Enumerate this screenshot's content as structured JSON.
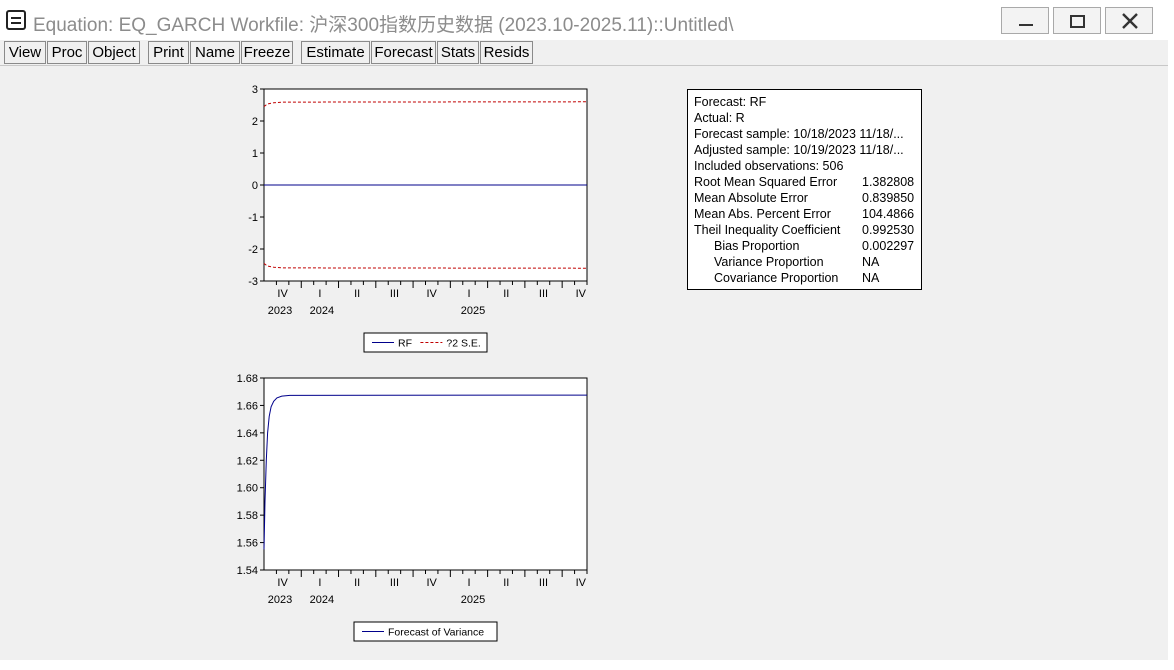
{
  "window": {
    "title": "Equation: EQ_GARCH   Workfile: 沪深300指数历史数据 (2023.10-2025.11)::Untitled\\",
    "controls": [
      "minimize",
      "maximize",
      "close"
    ]
  },
  "toolbar": {
    "buttons": [
      "View",
      "Proc",
      "Object",
      "Print",
      "Name",
      "Freeze",
      "Estimate",
      "Forecast",
      "Stats",
      "Resids"
    ]
  },
  "forecast_stats": {
    "rows": [
      {
        "label": "Forecast: RF",
        "value": ""
      },
      {
        "label": "Actual: R",
        "value": ""
      },
      {
        "label": "Forecast sample: 10/18/2023 11/18/...",
        "value": ""
      },
      {
        "label": "Adjusted sample: 10/19/2023 11/18/...",
        "value": ""
      },
      {
        "label": "Included observations: 506",
        "value": ""
      },
      {
        "label": "Root Mean Squared Error",
        "value": "1.382808"
      },
      {
        "label": "Mean Absolute Error",
        "value": "0.839850"
      },
      {
        "label": "Mean Abs. Percent Error",
        "value": "104.4866"
      },
      {
        "label": "Theil Inequality Coefficient",
        "value": "0.992530"
      },
      {
        "label": "Bias Proportion",
        "value": "0.002297",
        "indent": true
      },
      {
        "label": "Variance Proportion",
        "value": "NA",
        "indent": true
      },
      {
        "label": "Covariance Proportion",
        "value": "NA",
        "indent": true
      }
    ]
  },
  "chart_data": [
    {
      "type": "line",
      "x_ticks": [
        "IV",
        "I",
        "II",
        "III",
        "IV",
        "I",
        "II",
        "III",
        "IV"
      ],
      "year_labels": [
        "2023",
        "2024",
        "2025"
      ],
      "ylim": [
        -3,
        3
      ],
      "y_ticks": [
        "3",
        "2",
        "1",
        "0",
        "-1",
        "-2",
        "-3"
      ],
      "series": [
        {
          "name": "RF",
          "style": "solid",
          "color": "#00008b",
          "x": [
            0,
            0.5,
            1
          ],
          "values": [
            0.0,
            0.0,
            0.0
          ]
        },
        {
          "name": "?2 S.E.",
          "style": "dashed",
          "color": "#c00000",
          "x": [
            0,
            0.01,
            0.03,
            0.06,
            1
          ],
          "values": [
            2.45,
            2.53,
            2.57,
            2.59,
            2.6
          ]
        },
        {
          "name": "",
          "style": "dashed",
          "color": "#c00000",
          "x": [
            0,
            0.01,
            0.03,
            0.06,
            1
          ],
          "values": [
            -2.45,
            -2.53,
            -2.57,
            -2.59,
            -2.6
          ]
        }
      ],
      "legend": [
        "RF",
        "?2 S.E."
      ],
      "legend_placement": "bottom"
    },
    {
      "type": "line",
      "x_ticks": [
        "IV",
        "I",
        "II",
        "III",
        "IV",
        "I",
        "II",
        "III",
        "IV"
      ],
      "year_labels": [
        "2023",
        "2024",
        "2025"
      ],
      "ylim": [
        1.54,
        1.68
      ],
      "y_ticks": [
        "1.68",
        "1.66",
        "1.64",
        "1.62",
        "1.60",
        "1.58",
        "1.56",
        "1.54"
      ],
      "series": [
        {
          "name": "Forecast of Variance",
          "style": "solid",
          "color": "#00008b",
          "x": [
            0,
            0.003,
            0.007,
            0.011,
            0.016,
            0.022,
            0.03,
            0.04,
            0.055,
            0.08,
            1
          ],
          "values": [
            1.555,
            1.59,
            1.62,
            1.64,
            1.652,
            1.659,
            1.663,
            1.6655,
            1.6668,
            1.6673,
            1.6675
          ]
        }
      ],
      "legend": [
        "Forecast of Variance"
      ],
      "legend_placement": "bottom"
    }
  ]
}
